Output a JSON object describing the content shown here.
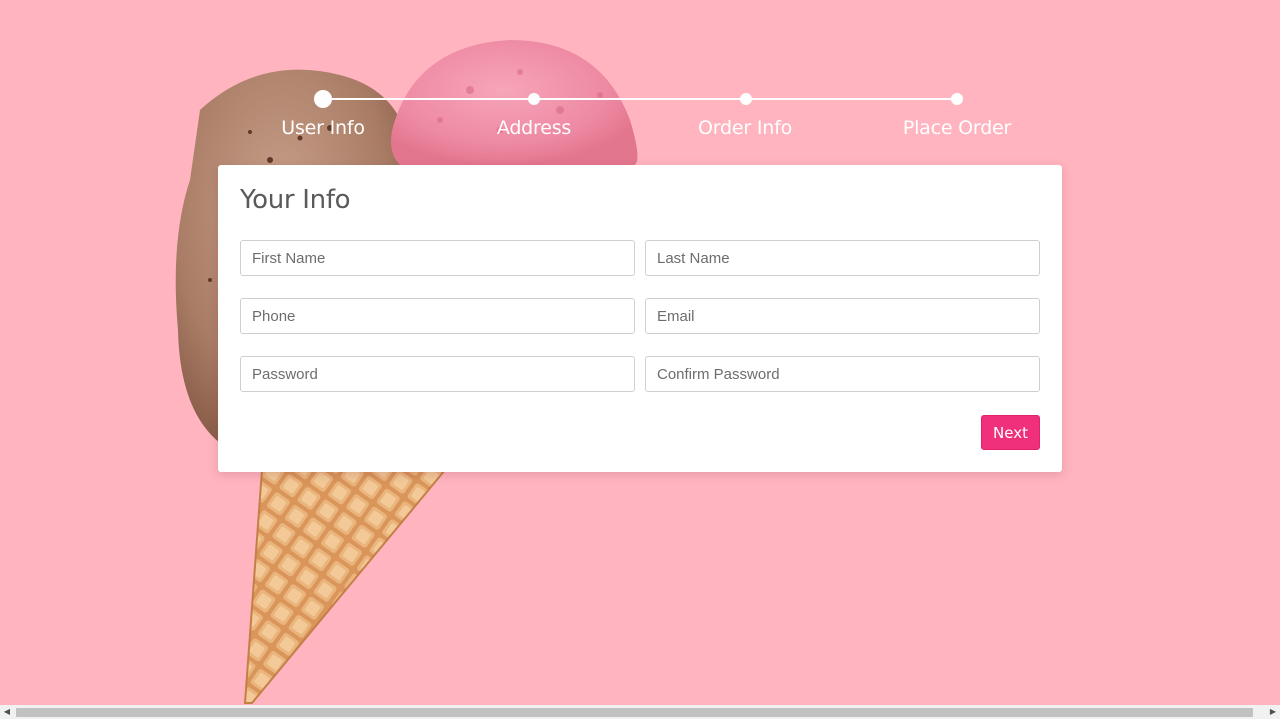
{
  "colors": {
    "background": "#ffb4bf",
    "accent": "#f0307a",
    "stepper": "#ffffff",
    "card": "#ffffff"
  },
  "background_image": "ice-cream-cone-illustration",
  "stepper": {
    "steps": [
      {
        "label": "User Info",
        "active": true
      },
      {
        "label": "Address",
        "active": false
      },
      {
        "label": "Order Info",
        "active": false
      },
      {
        "label": "Place Order",
        "active": false
      }
    ]
  },
  "form": {
    "title": "Your Info",
    "fields": {
      "first_name": {
        "placeholder": "First Name",
        "value": ""
      },
      "last_name": {
        "placeholder": "Last Name",
        "value": ""
      },
      "phone": {
        "placeholder": "Phone",
        "value": ""
      },
      "email": {
        "placeholder": "Email",
        "value": ""
      },
      "password": {
        "placeholder": "Password",
        "value": ""
      },
      "confirm_password": {
        "placeholder": "Confirm Password",
        "value": ""
      }
    },
    "next_label": "Next"
  },
  "scrollbar": {
    "left_icon": "caret-left-icon",
    "right_icon": "caret-right-icon"
  }
}
